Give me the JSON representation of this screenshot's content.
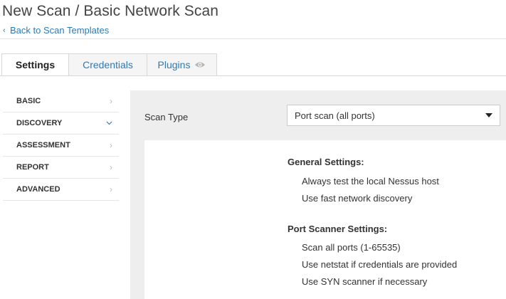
{
  "header": {
    "title": "New Scan / Basic Network Scan",
    "back_link": "Back to Scan Templates"
  },
  "tabs": [
    {
      "label": "Settings",
      "active": true
    },
    {
      "label": "Credentials",
      "active": false
    },
    {
      "label": "Plugins",
      "active": false,
      "icon": "eye-icon"
    }
  ],
  "sidebar": {
    "items": [
      {
        "label": "BASIC",
        "expanded": false
      },
      {
        "label": "DISCOVERY",
        "expanded": true
      },
      {
        "label": "ASSESSMENT",
        "expanded": false
      },
      {
        "label": "REPORT",
        "expanded": false
      },
      {
        "label": "ADVANCED",
        "expanded": false
      }
    ]
  },
  "form": {
    "scan_type_label": "Scan Type",
    "scan_type_value": "Port scan (all ports)"
  },
  "summary": {
    "general": {
      "title": "General Settings:",
      "items": [
        "Always test the local Nessus host",
        "Use fast network discovery"
      ]
    },
    "port_scanner": {
      "title": "Port Scanner Settings:",
      "items": [
        "Scan all ports (1-65535)",
        "Use netstat if credentials are provided",
        "Use SYN scanner if necessary"
      ]
    }
  },
  "colors": {
    "link": "#2b7bb9",
    "panel_bg": "#eeeeee"
  }
}
